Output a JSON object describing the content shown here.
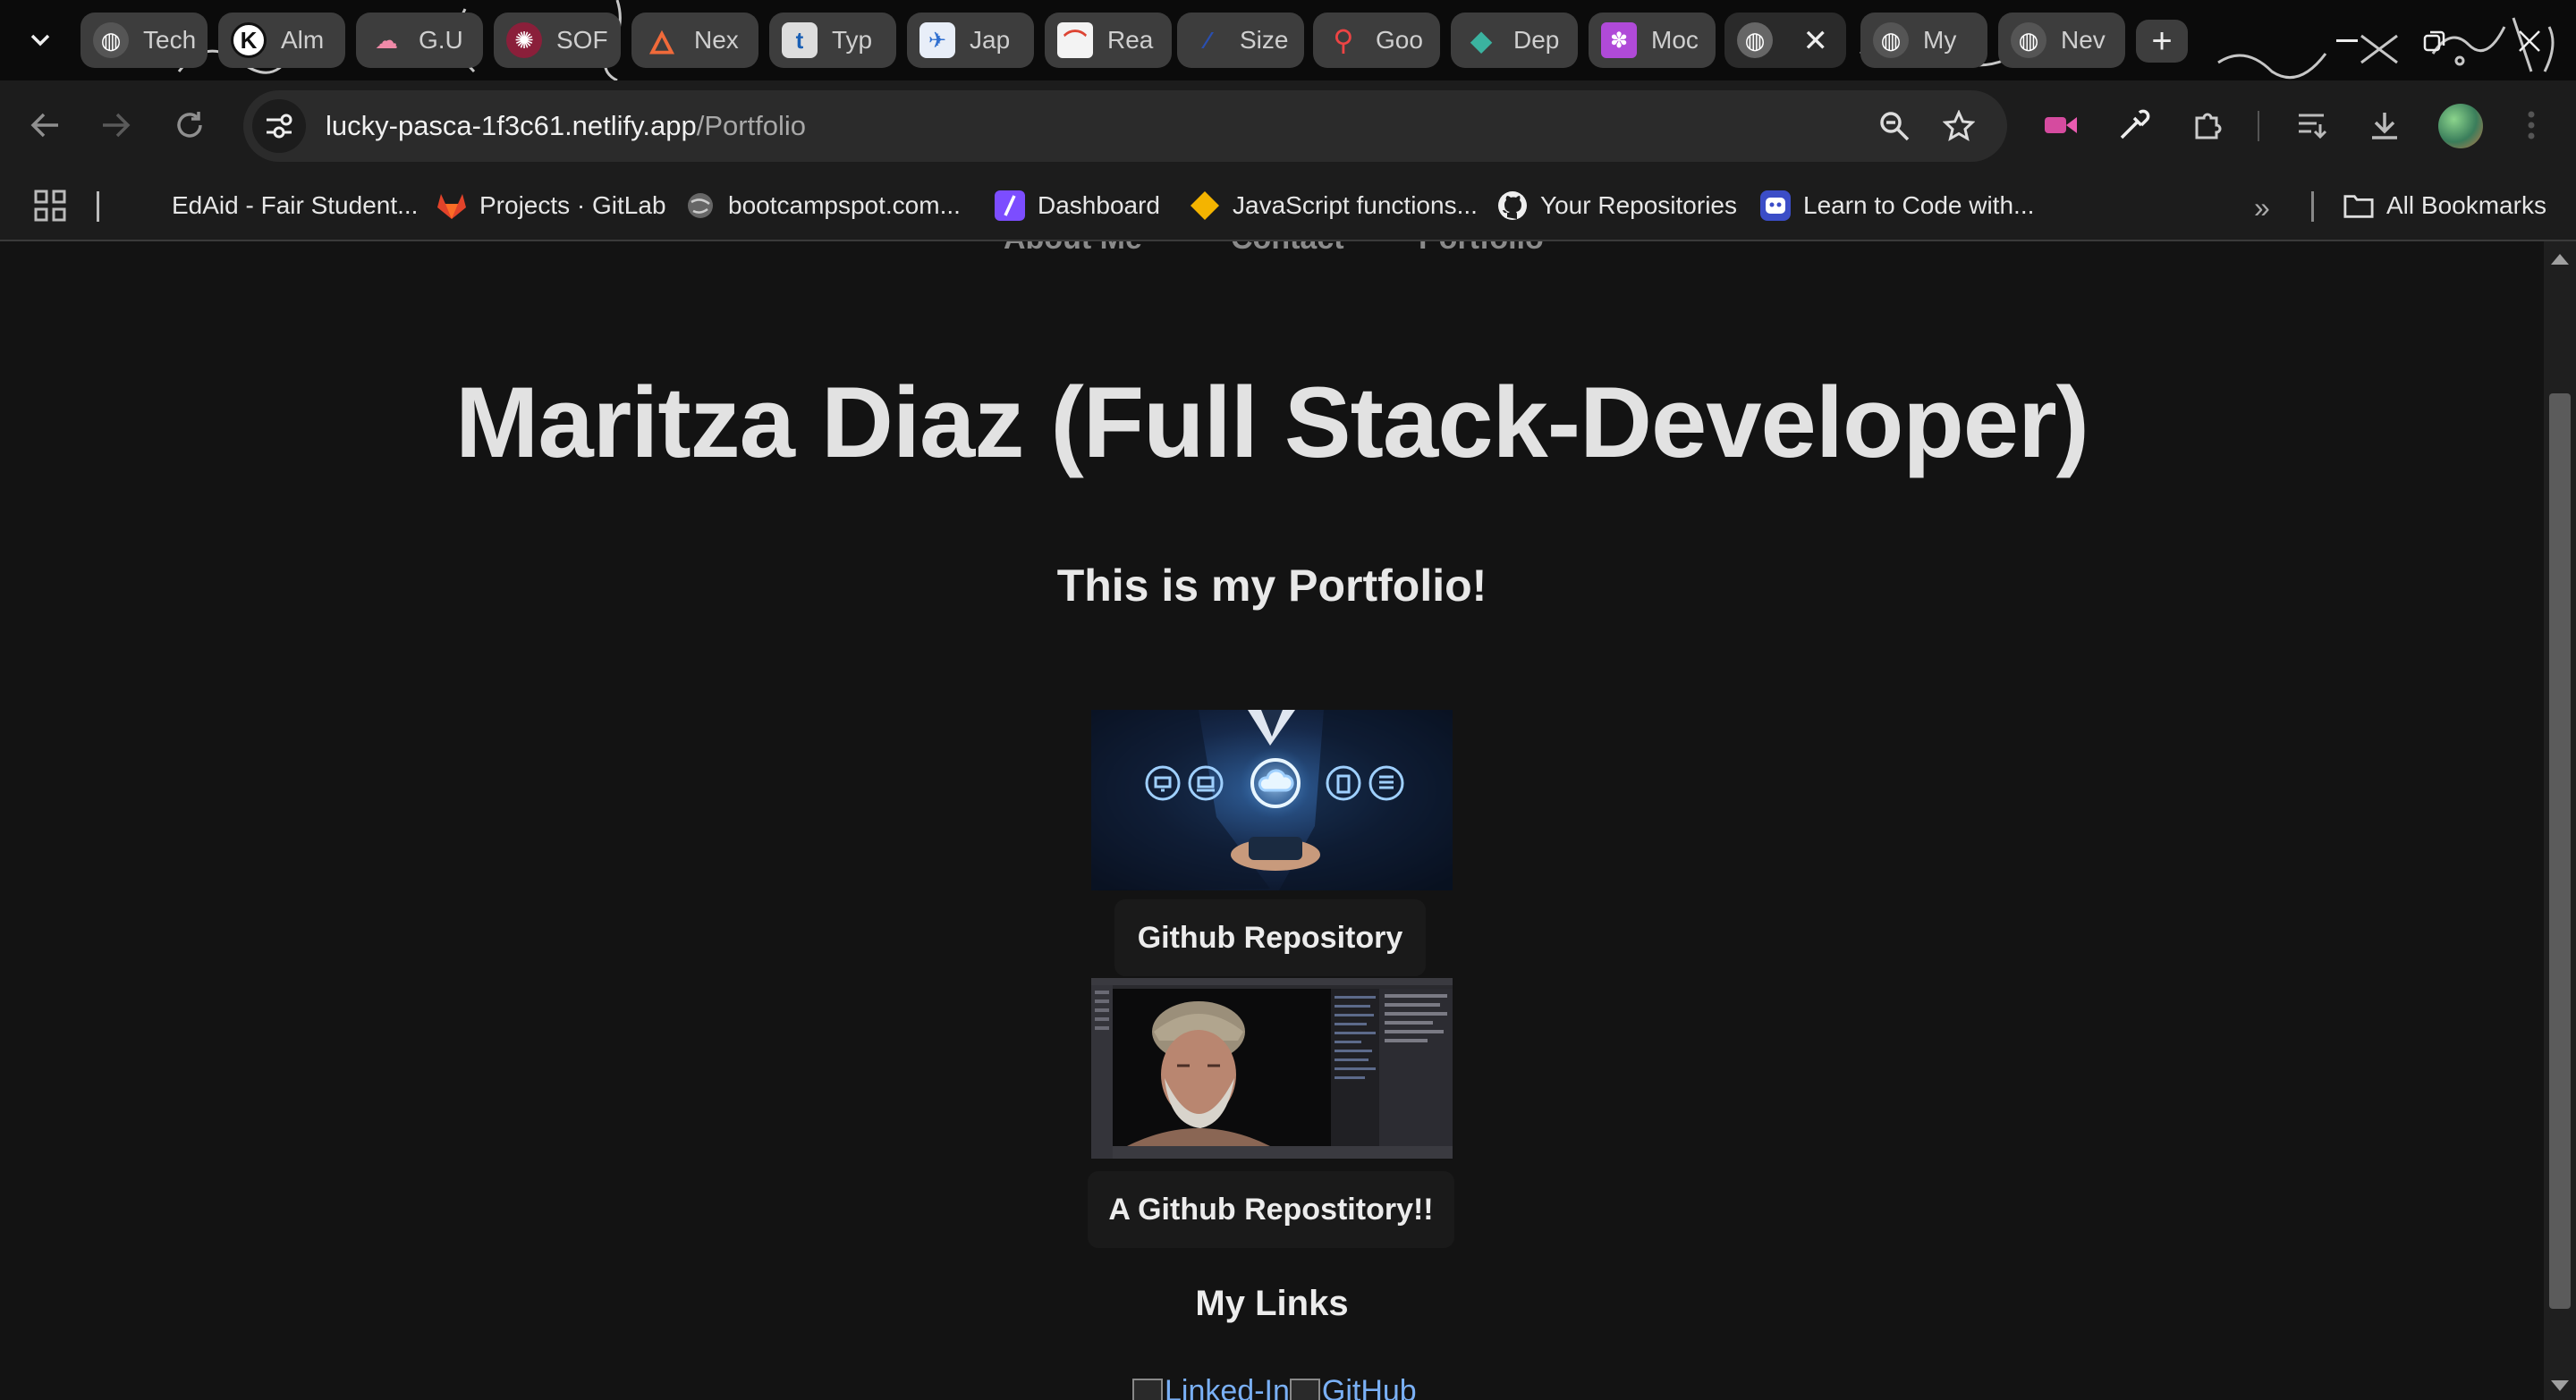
{
  "browser": {
    "tabs": [
      {
        "title": "Tech",
        "icon": "globe-icon"
      },
      {
        "title": "Alm",
        "icon": "k-logo-icon"
      },
      {
        "title": "G.U",
        "icon": "brain-icon"
      },
      {
        "title": "SOF",
        "icon": "red-circle-icon"
      },
      {
        "title": "Nex",
        "icon": "flame-icon"
      },
      {
        "title": "Typ",
        "icon": "t-logo-icon"
      },
      {
        "title": "Jap",
        "icon": "plane-icon"
      },
      {
        "title": "Rea",
        "icon": "rainbow-icon"
      },
      {
        "title": "Size",
        "icon": "blue-stroke-icon"
      },
      {
        "title": "Goo",
        "icon": "map-pin-icon"
      },
      {
        "title": "Dep",
        "icon": "gem-icon"
      },
      {
        "title": "Moc",
        "icon": "purple-pattern-icon"
      },
      {
        "title": "",
        "icon": "globe-icon",
        "active": true
      },
      {
        "title": "My",
        "icon": "globe-icon"
      },
      {
        "title": "Nev",
        "icon": "globe-icon"
      }
    ],
    "url": {
      "host": "lucky-pasca-1f3c61.netlify.app",
      "path": "/Portfolio"
    },
    "bookmarks": [
      {
        "label": "EdAid - Fair Student...",
        "icon": "none"
      },
      {
        "label": "Projects · GitLab",
        "icon": "gitlab-icon"
      },
      {
        "label": "bootcampspot.com...",
        "icon": "globe-icon"
      },
      {
        "label": "Dashboard",
        "icon": "dashboard-icon"
      },
      {
        "label": "JavaScript functions...",
        "icon": "diamond-icon"
      },
      {
        "label": "Your Repositories",
        "icon": "github-icon"
      },
      {
        "label": "Learn to Code with...",
        "icon": "robot-icon"
      }
    ],
    "all_bookmarks_label": "All Bookmarks"
  },
  "page": {
    "nav": [
      "About Me",
      "Contact",
      "Portfolio"
    ],
    "title": "Maritza Diaz (Full Stack-Developer)",
    "subtitle": "This is my Portfolio!",
    "projects": [
      {
        "image": "cloud-hand-image",
        "button": "Github Repository"
      },
      {
        "image": "old-man-render-image",
        "button": "A Github Repostitory!!"
      }
    ],
    "links_title": "My Links",
    "links": [
      {
        "alt": "Linked-In"
      },
      {
        "alt": "GitHub"
      }
    ]
  },
  "colors": {
    "page_bg": "#131313",
    "toolbar_bg": "#1c1c1c",
    "tab_bg": "#3d3d3d",
    "title_text": "#e2e2e2",
    "link_alt": "#7ab0f5"
  }
}
